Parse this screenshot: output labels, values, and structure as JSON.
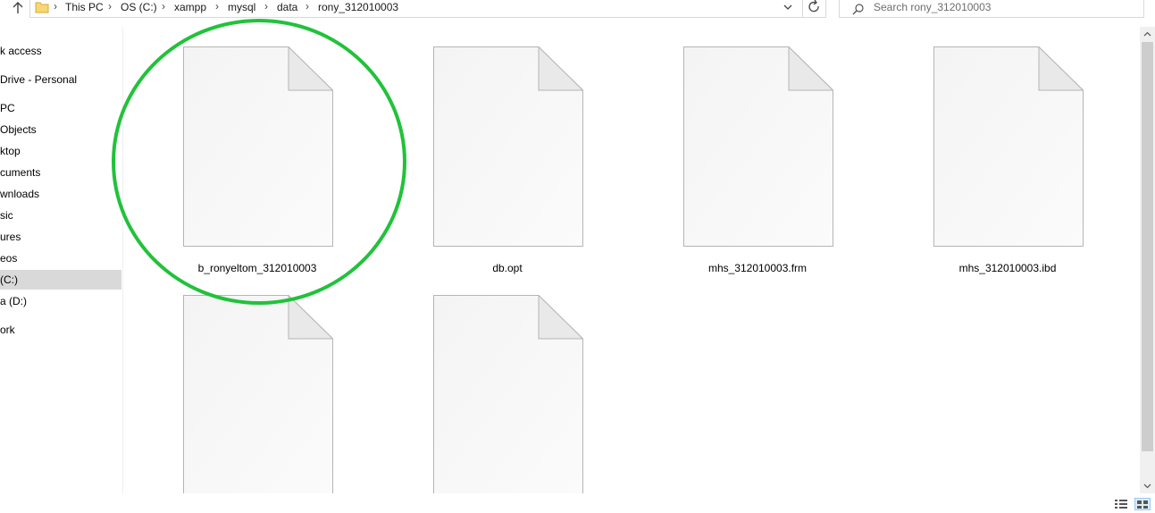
{
  "address_bar": {
    "breadcrumbs": [
      "This PC",
      "OS (C:)",
      "xampp",
      "mysql",
      "data",
      "rony_312010003"
    ]
  },
  "search": {
    "placeholder": "Search rony_312010003"
  },
  "nav_pane": {
    "items": [
      {
        "label": "k access",
        "icon": "star-icon"
      },
      {
        "label": "Drive - Personal",
        "icon": "cloud-icon"
      },
      {
        "label": "PC",
        "icon": "computer-icon"
      },
      {
        "label": "Objects",
        "icon": "cube-icon"
      },
      {
        "label": "ktop",
        "icon": "desktop-icon"
      },
      {
        "label": "cuments",
        "icon": "document-icon"
      },
      {
        "label": "wnloads",
        "icon": "download-icon"
      },
      {
        "label": "sic",
        "icon": "music-icon"
      },
      {
        "label": "ures",
        "icon": "pictures-icon"
      },
      {
        "label": "eos",
        "icon": "video-icon"
      },
      {
        "label": "(C:)",
        "icon": "drive-icon",
        "selected": true
      },
      {
        "label": "a (D:)",
        "icon": "drive-icon"
      },
      {
        "label": "ork",
        "icon": "network-icon"
      }
    ]
  },
  "files": [
    {
      "name": "b_ronyeltom_312010003",
      "icon": "generic-file-icon",
      "highlighted": true
    },
    {
      "name": "db.opt",
      "icon": "generic-file-icon"
    },
    {
      "name": "mhs_312010003.frm",
      "icon": "generic-file-icon"
    },
    {
      "name": "mhs_312010003.ibd",
      "icon": "generic-file-icon"
    },
    {
      "name": "",
      "icon": "generic-file-icon"
    },
    {
      "name": "",
      "icon": "generic-file-icon"
    }
  ],
  "colors": {
    "highlight_circle": "#21c23a",
    "selection": "#d9d9d9",
    "border": "#d9d9d9"
  }
}
